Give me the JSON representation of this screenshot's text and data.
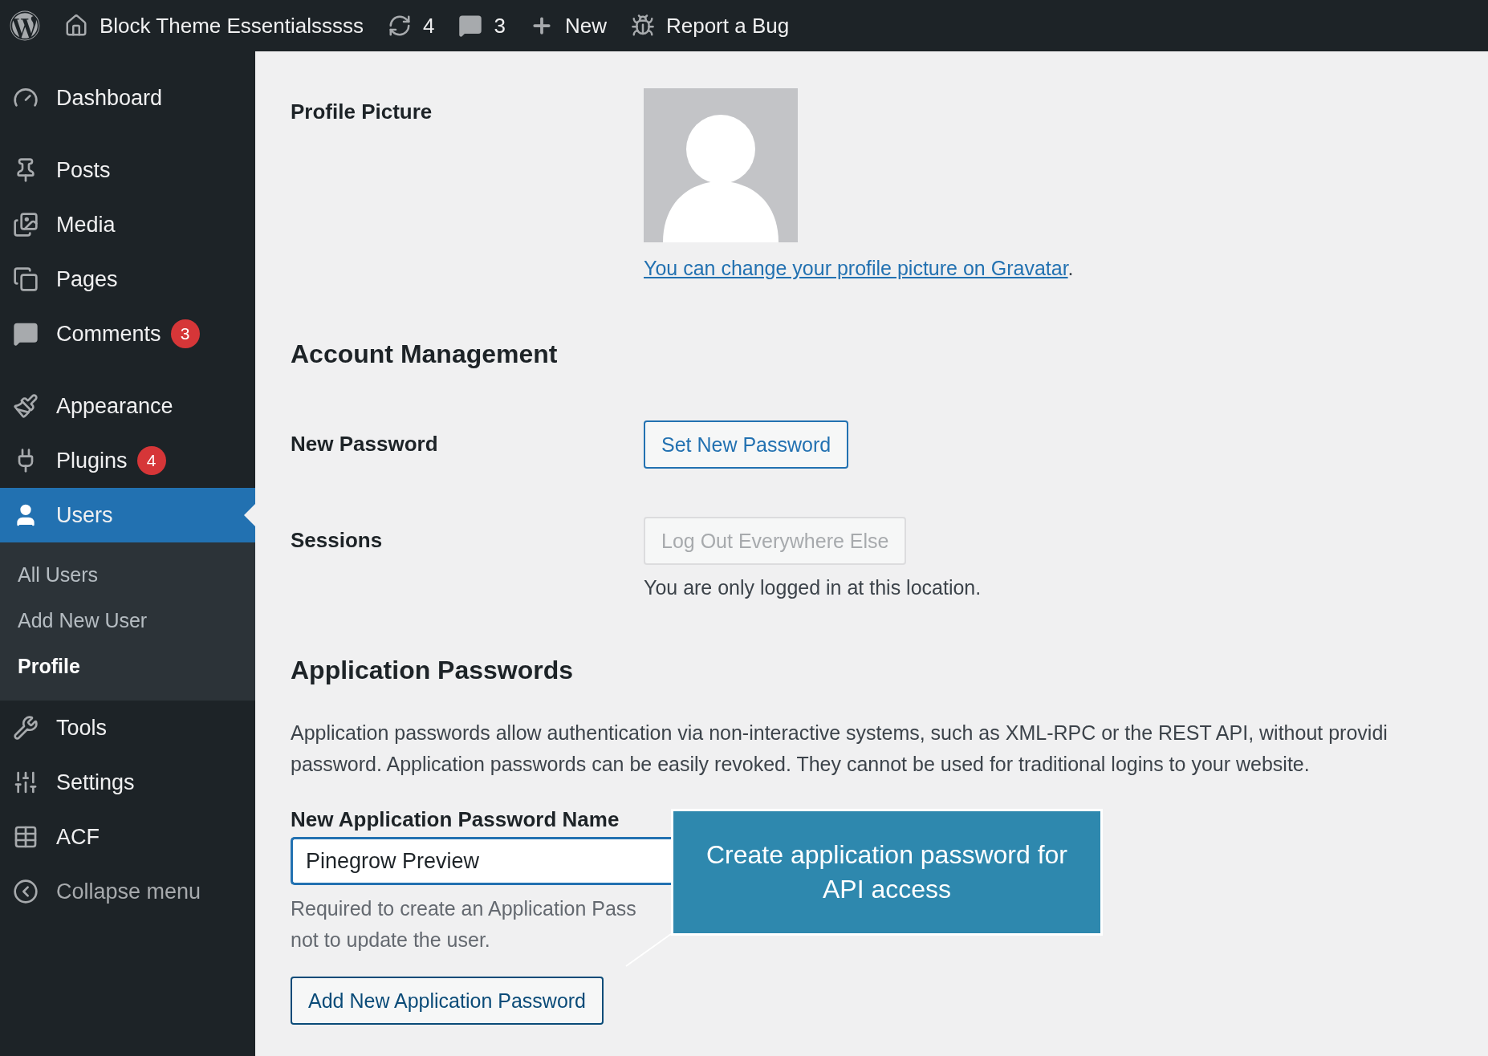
{
  "admin_bar": {
    "items": [
      {
        "kind": "logo"
      },
      {
        "kind": "home",
        "label": "Block Theme Essentialsssss"
      },
      {
        "kind": "updates",
        "label": "4"
      },
      {
        "kind": "comments",
        "label": "3"
      },
      {
        "kind": "new",
        "label": "New"
      },
      {
        "kind": "bug",
        "label": "Report a Bug"
      }
    ]
  },
  "sidebar": {
    "items": [
      {
        "label": "Dashboard",
        "selected": false
      },
      {
        "label": "Posts",
        "selected": false
      },
      {
        "label": "Media",
        "selected": false
      },
      {
        "label": "Pages",
        "selected": false
      },
      {
        "label": "Comments",
        "badge": "3",
        "selected": false
      },
      {
        "label": "Appearance",
        "selected": false
      },
      {
        "label": "Plugins",
        "badge": "4",
        "selected": false
      },
      {
        "label": "Users",
        "selected": true,
        "children": [
          {
            "label": "All Users",
            "selected": false
          },
          {
            "label": "Add New User",
            "selected": false
          },
          {
            "label": "Profile",
            "selected": true
          }
        ]
      },
      {
        "label": "Tools",
        "selected": false
      },
      {
        "label": "Settings",
        "selected": false
      },
      {
        "label": "ACF",
        "selected": false
      },
      {
        "label": "Collapse menu",
        "selected": false,
        "kind": "collapse"
      }
    ]
  },
  "profile_picture": {
    "label": "Profile Picture",
    "link": "You can change your profile picture on Gravatar",
    "after": "."
  },
  "account_management": {
    "heading": "Account Management",
    "new_password": {
      "label": "New Password",
      "button": "Set New Password"
    },
    "sessions": {
      "label": "Sessions",
      "button": "Log Out Everywhere Else",
      "button_disabled": true,
      "note": "You are only logged in at this location."
    }
  },
  "application_passwords": {
    "heading": "Application Passwords",
    "description": [
      "Application passwords allow authentication via non-interactive systems, such as XML-RPC or the REST API, without providi",
      "password. Application passwords can be easily revoked. They cannot be used for traditional logins to your website."
    ],
    "name_label": "New Application Password Name",
    "name_value": "Pinegrow Preview",
    "help": [
      "Required to create an Application Pass",
      "not to update the user."
    ],
    "button": "Add New Application Password"
  },
  "callout": {
    "text": "Create application password for API access"
  }
}
